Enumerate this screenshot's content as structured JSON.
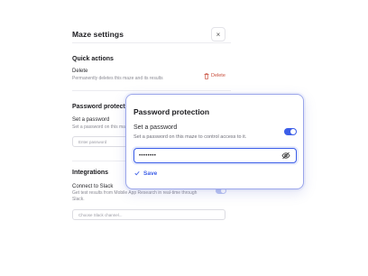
{
  "panel": {
    "title": "Maze settings",
    "close_glyph": "×",
    "quick_actions": {
      "heading": "Quick actions",
      "delete_label": "Delete",
      "delete_desc": "Permanently deletes this maze and its results",
      "delete_button": "Delete"
    },
    "password_section": {
      "heading": "Password protection",
      "label": "Set a password",
      "desc": "Set a password on this maze",
      "input_placeholder": "Enter password"
    },
    "integrations": {
      "heading": "Integrations",
      "slack_label": "Connect to Slack",
      "slack_desc_1": "Get test results from Mobile App Research in real-time through",
      "slack_desc_2": "Slack.",
      "channel_placeholder": "Choose Slack channel..."
    }
  },
  "modal": {
    "title": "Password protection",
    "label": "Set a password",
    "desc": "Set a password on this maze to control access to it.",
    "password_value": "••••••••",
    "save_label": "Save",
    "toggle_on": true
  },
  "colors": {
    "accent": "#3c5ee8",
    "danger": "#c9503e"
  },
  "icons": [
    "close-icon",
    "trash-icon",
    "eye-off-icon",
    "check-icon"
  ]
}
